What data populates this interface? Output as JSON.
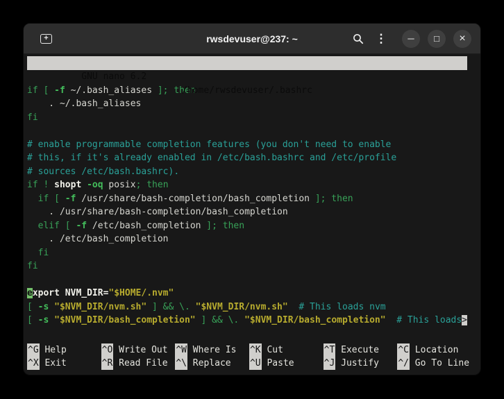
{
  "window": {
    "title": "rwsdevuser@237: ~",
    "icons": {
      "new_tab_plus": "+",
      "menu": "⋮",
      "minimize": "─",
      "maximize": "□",
      "close": "×"
    }
  },
  "nano": {
    "version": "GNU nano 6.2",
    "file_path": "/home/rwsdevuser/.bashrc"
  },
  "editor": {
    "lines": [
      [],
      [
        {
          "t": "if [ ",
          "c": "kw"
        },
        {
          "t": "-f",
          "c": "opt"
        },
        {
          "t": " ~/.bash_aliases ",
          "c": "txt"
        },
        {
          "t": "]; then",
          "c": "kw"
        }
      ],
      [
        {
          "t": "    . ~/.bash_aliases",
          "c": "txt"
        }
      ],
      [
        {
          "t": "fi",
          "c": "kw"
        }
      ],
      [],
      [
        {
          "t": "# enable programmable completion features (you don't need to enable",
          "c": "com"
        }
      ],
      [
        {
          "t": "# this, if it's already enabled in /etc/bash.bashrc and /etc/profile",
          "c": "com"
        }
      ],
      [
        {
          "t": "# sources /etc/bash.bashrc).",
          "c": "com"
        }
      ],
      [
        {
          "t": "if ! ",
          "c": "kw"
        },
        {
          "t": "shopt ",
          "c": "txtb"
        },
        {
          "t": "-oq",
          "c": "opt"
        },
        {
          "t": " posix",
          "c": "txt"
        },
        {
          "t": "; then",
          "c": "kw"
        }
      ],
      [
        {
          "t": "  ",
          "c": "txt"
        },
        {
          "t": "if [ ",
          "c": "kw"
        },
        {
          "t": "-f",
          "c": "opt"
        },
        {
          "t": " /usr/share/bash-completion/bash_completion ",
          "c": "txt"
        },
        {
          "t": "]; then",
          "c": "kw"
        }
      ],
      [
        {
          "t": "    . /usr/share/bash-completion/bash_completion",
          "c": "txt"
        }
      ],
      [
        {
          "t": "  ",
          "c": "txt"
        },
        {
          "t": "elif [ ",
          "c": "kw"
        },
        {
          "t": "-f",
          "c": "opt"
        },
        {
          "t": " /etc/bash_completion ",
          "c": "txt"
        },
        {
          "t": "]; then",
          "c": "kw"
        }
      ],
      [
        {
          "t": "    . /etc/bash_completion",
          "c": "txt"
        }
      ],
      [
        {
          "t": "  fi",
          "c": "kw"
        }
      ],
      [
        {
          "t": "fi",
          "c": "kw"
        }
      ],
      [],
      [
        {
          "t": "e",
          "c": "cursor"
        },
        {
          "t": "xport NVM_DIR=",
          "c": "txtb"
        },
        {
          "t": "\"$HOME/.nvm\"",
          "c": "str"
        }
      ],
      [
        {
          "t": "[ ",
          "c": "kw"
        },
        {
          "t": "-s",
          "c": "opt"
        },
        {
          "t": " ",
          "c": "txt"
        },
        {
          "t": "\"$NVM_DIR/nvm.sh\"",
          "c": "str"
        },
        {
          "t": " ] && \\. ",
          "c": "kw"
        },
        {
          "t": "\"$NVM_DIR/nvm.sh\"",
          "c": "str"
        },
        {
          "t": "  ",
          "c": "txt"
        },
        {
          "t": "# This loads nvm",
          "c": "com"
        }
      ],
      [
        {
          "t": "[ ",
          "c": "kw"
        },
        {
          "t": "-s",
          "c": "opt"
        },
        {
          "t": " ",
          "c": "txt"
        },
        {
          "t": "\"$NVM_DIR/bash_completion\"",
          "c": "str"
        },
        {
          "t": " ] && \\. ",
          "c": "kw"
        },
        {
          "t": "\"$NVM_DIR/bash_completion\"",
          "c": "str"
        },
        {
          "t": "  ",
          "c": "txt"
        },
        {
          "t": "# This loads",
          "c": "com"
        },
        {
          "t": ">",
          "c": "more"
        }
      ]
    ]
  },
  "shortcuts": [
    {
      "key": "^G",
      "label": "Help"
    },
    {
      "key": "^O",
      "label": "Write Out"
    },
    {
      "key": "^W",
      "label": "Where Is"
    },
    {
      "key": "^K",
      "label": "Cut"
    },
    {
      "key": "^T",
      "label": "Execute"
    },
    {
      "key": "^C",
      "label": "Location"
    },
    {
      "key": "^X",
      "label": "Exit"
    },
    {
      "key": "^R",
      "label": "Read File"
    },
    {
      "key": "^\\",
      "label": "Replace"
    },
    {
      "key": "^U",
      "label": "Paste"
    },
    {
      "key": "^J",
      "label": "Justify"
    },
    {
      "key": "^/",
      "label": "Go To Line"
    }
  ],
  "colors": {
    "keyword_green": "#38a258",
    "option_green": "#43bd5b",
    "comment_teal": "#2aa198",
    "string_yellow": "#b7ab2e",
    "text": "#d6d6d0",
    "cursor_bg": "#74c06a",
    "nano_bar_bg": "#d0cfcc",
    "terminal_bg": "#181818",
    "titlebar_bg": "#2d2d2d"
  }
}
